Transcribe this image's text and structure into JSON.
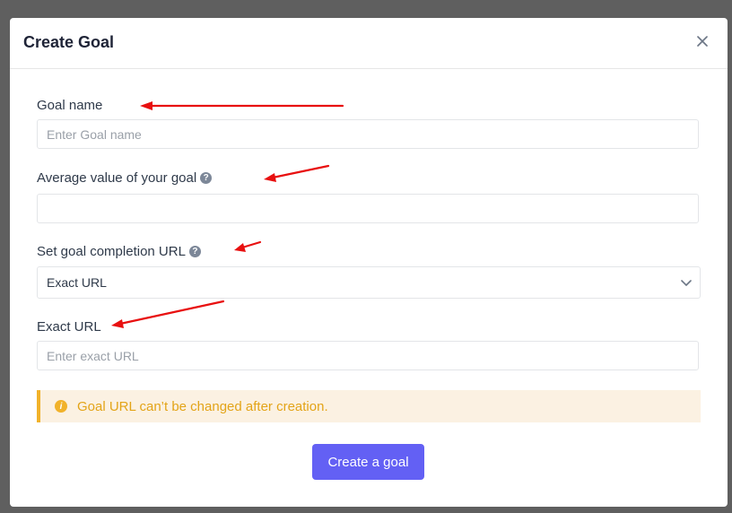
{
  "modal": {
    "title": "Create Goal",
    "close_label": "×"
  },
  "form": {
    "goal_name": {
      "label": "Goal name",
      "placeholder": "Enter Goal name",
      "value": ""
    },
    "average_value": {
      "label": "Average value of your goal",
      "value": ""
    },
    "completion_url": {
      "label": "Set goal completion URL",
      "selected": "Exact URL"
    },
    "exact_url": {
      "label": "Exact URL",
      "placeholder": "Enter exact URL",
      "value": ""
    }
  },
  "notice": {
    "text": "Goal URL can’t be changed after creation."
  },
  "actions": {
    "create_label": "Create a goal"
  },
  "colors": {
    "accent": "#6360f4",
    "warning": "#f1b22a",
    "annotation": "#e81010"
  },
  "icons": [
    "close-icon",
    "help-icon",
    "chevron-down-icon",
    "info-icon",
    "red-annotation-arrow"
  ]
}
